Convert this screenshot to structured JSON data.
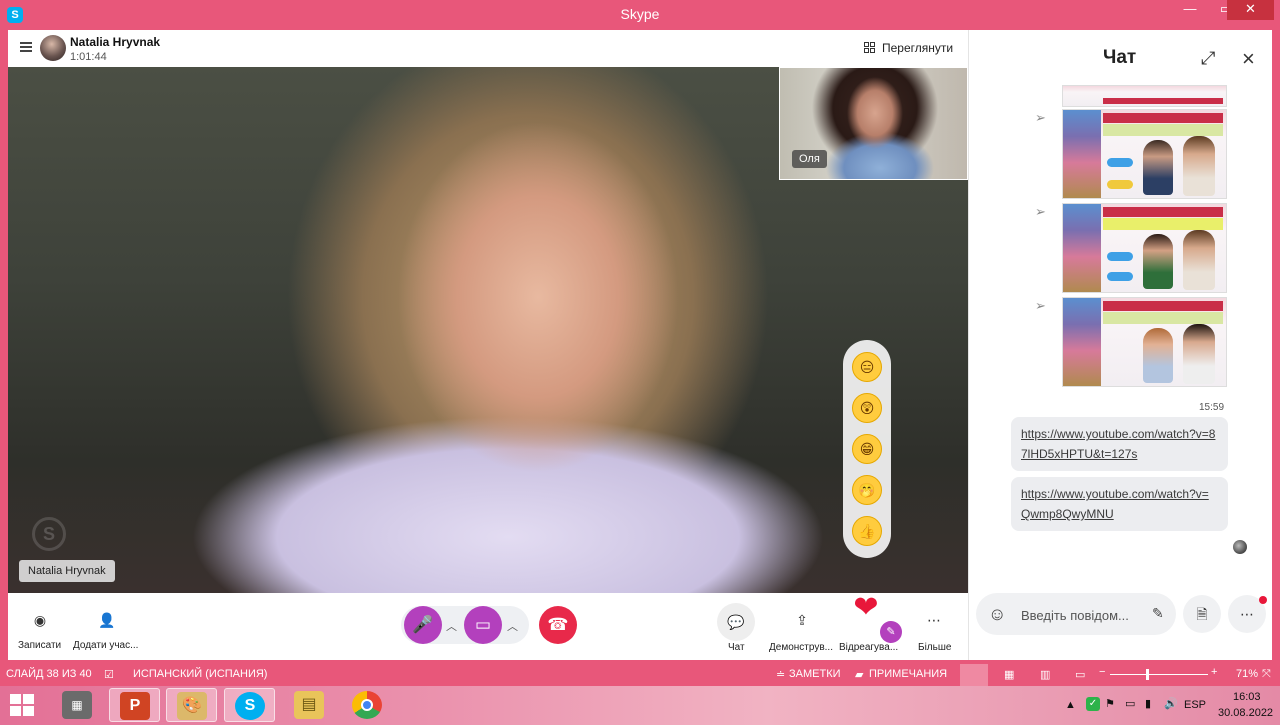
{
  "window": {
    "title": "Skype",
    "app_icon": "S",
    "minimize": "—",
    "restore": "▭",
    "close": "✕"
  },
  "call": {
    "caller_name": "Natalia Hryvnak",
    "duration": "1:01:44",
    "review_label": "Переглянути",
    "pip_label": "Оля",
    "video_name_tag": "Natalia Hryvnak"
  },
  "reactions": {
    "icons": [
      "😑",
      "😲",
      "😁",
      "🤭",
      "👍"
    ],
    "heart": "❤"
  },
  "controls": {
    "record_label": "Записати",
    "add_label": "Додати учас...",
    "chat_label": "Чат",
    "share_label": "Демонструв...",
    "react_label": "Відреагува...",
    "more_label": "Більше",
    "mic_color": "#b340bd",
    "video_color": "#b340bd",
    "hangup_color": "#e8294a"
  },
  "chat": {
    "title": "Чат",
    "time": "15:59",
    "messages": [
      {
        "text": "https://www.youtube.com/watch?v=87lHD5xHPTU&t=127s"
      },
      {
        "text": "https://www.youtube.com/watch?v=Qwmp8QwyMNU"
      }
    ],
    "input_placeholder": "Введіть повідом..."
  },
  "ppt_status": {
    "slide": "СЛАЙД 38 ИЗ 40",
    "language": "ИСПАНСКИЙ (ИСПАНИЯ)",
    "notes": "ЗАМЕТКИ",
    "comments": "ПРИМЕЧАНИЯ",
    "zoom": "71%",
    "minus": "−",
    "plus": "+"
  },
  "taskbar": {
    "apps": [
      "PowerPoint",
      "Paint",
      "Skype",
      "Explorer",
      "Chrome"
    ],
    "lang": "ESP",
    "time": "16:03",
    "date": "30.08.2022"
  },
  "colors": {
    "accent": "#e8577a",
    "brand": "#00aff0"
  }
}
